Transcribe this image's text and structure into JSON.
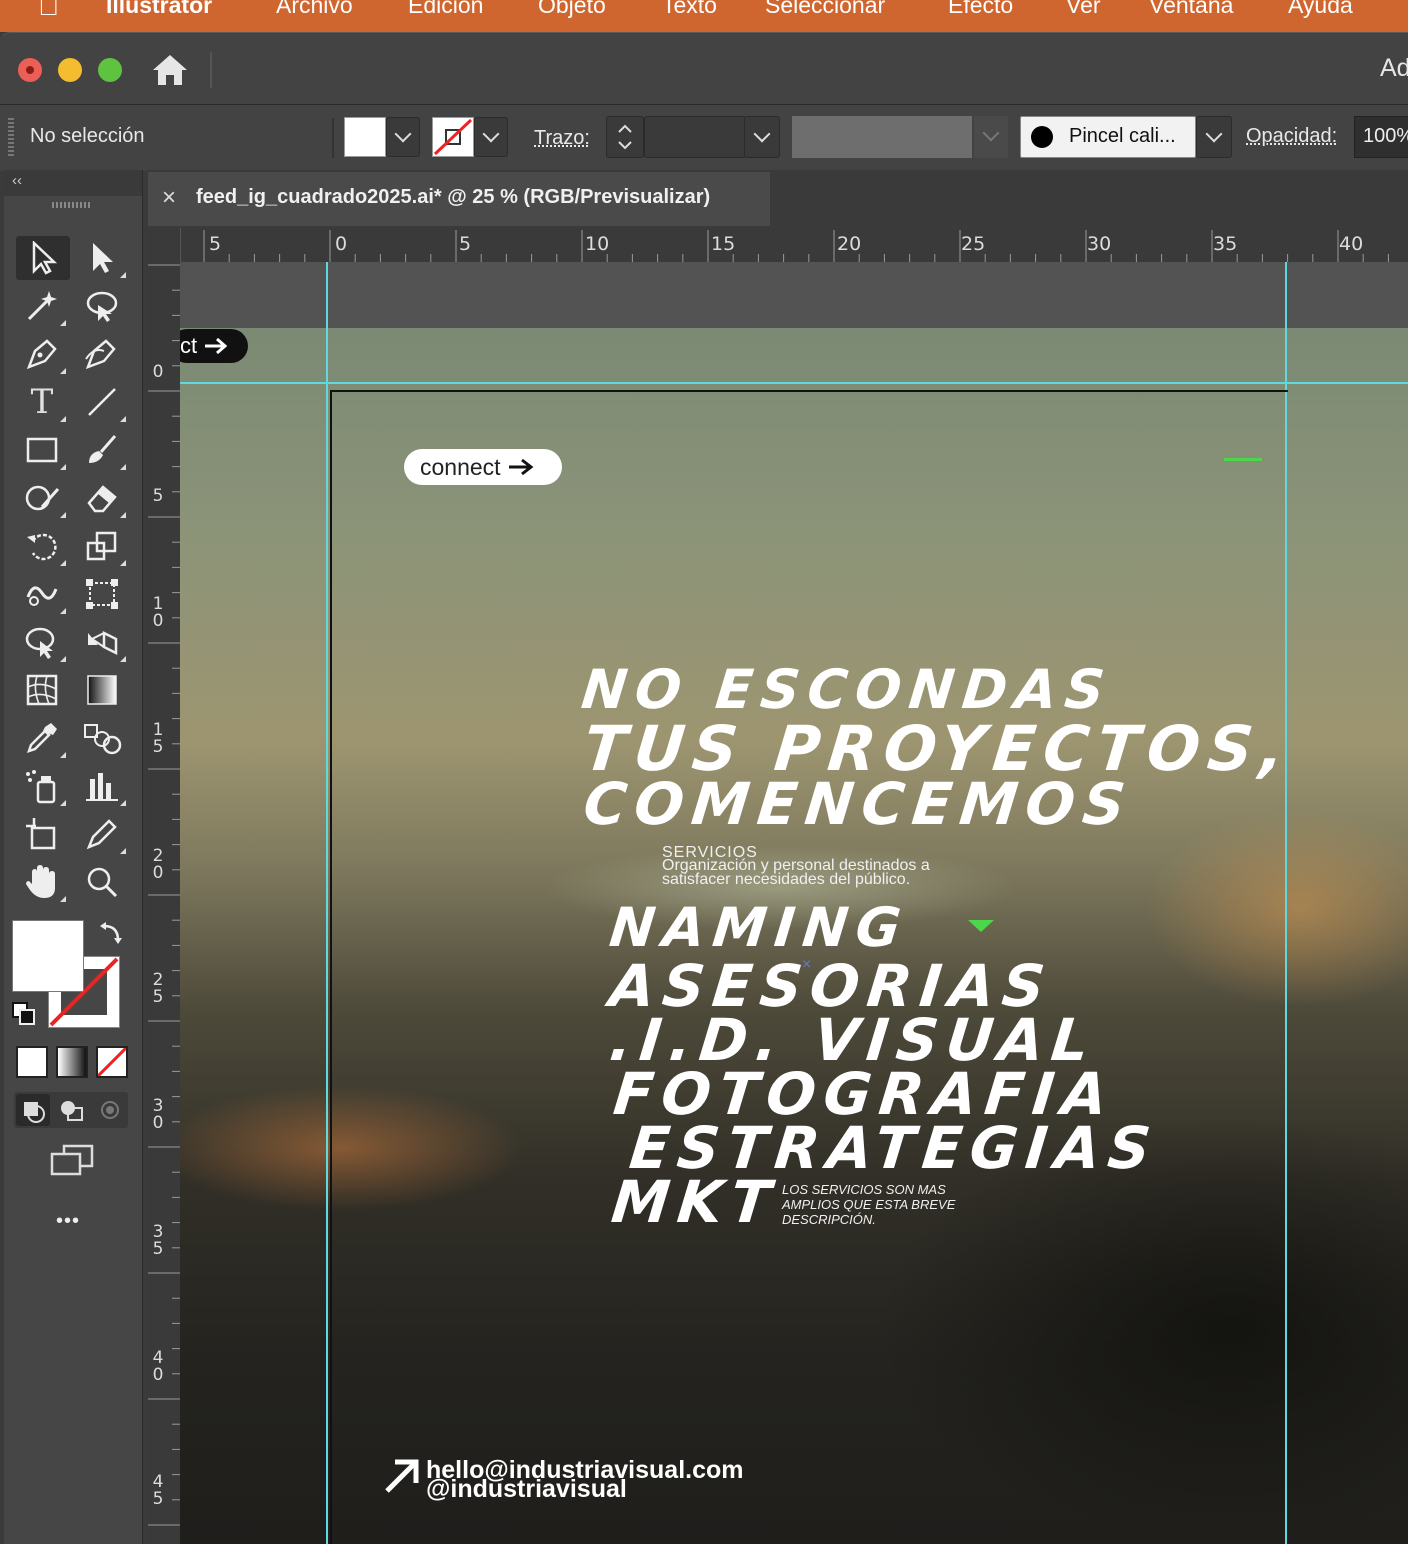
{
  "menubar": {
    "apple": "",
    "app_name": "Illustrator",
    "items": [
      "Archivo",
      "Edición",
      "Objeto",
      "Texto",
      "Seleccionar",
      "Efecto",
      "Ver",
      "Ventana",
      "Ayuda"
    ]
  },
  "titlebar": {
    "right_text": "Ad"
  },
  "control_bar": {
    "selection_label": "No selección",
    "stroke_label": "Trazo:",
    "brush_label": "Pincel cali...",
    "opacity_label": "Opacidad:",
    "opacity_value": "100%"
  },
  "document_tab": {
    "close": "×",
    "title": "feed_ig_cuadrado2025.ai* @ 25 % (RGB/Previsualizar)"
  },
  "rulers": {
    "horizontal": [
      "5",
      "0",
      "5",
      "10",
      "15",
      "20",
      "25",
      "30",
      "35",
      "40"
    ],
    "vertical": [
      "0",
      "5",
      "10",
      "15",
      "20",
      "25",
      "30",
      "35",
      "40",
      "45"
    ]
  },
  "toolbar": {
    "collapse": "‹‹",
    "more": "•••"
  },
  "artwork": {
    "pill_partial": "ct",
    "pill_connect": "connect",
    "headline": [
      "NO ESCONDAS",
      "TUS PROYECTOS,",
      "COMENCEMOS"
    ],
    "services_title": "SERVICIOS",
    "services_desc": [
      "Organización y personal destinados a",
      "satisfacer necesidades del público."
    ],
    "services_list": [
      "NAMING",
      "ASESORIAS",
      ".I.D. VISUAL",
      "FOTOGRAFIA",
      "ESTRATEGIAS",
      "MKT"
    ],
    "note": [
      "LOS SERVICIOS SON MAS",
      "AMPLIOS QUE ESTA BREVE",
      "DESCRIPCIÓN."
    ],
    "email": "hello@industriavisual.com",
    "handle": "@industriavisual"
  },
  "colors": {
    "menubar": "#d0662f",
    "guide": "#5fd8e0",
    "panel": "#434343"
  }
}
